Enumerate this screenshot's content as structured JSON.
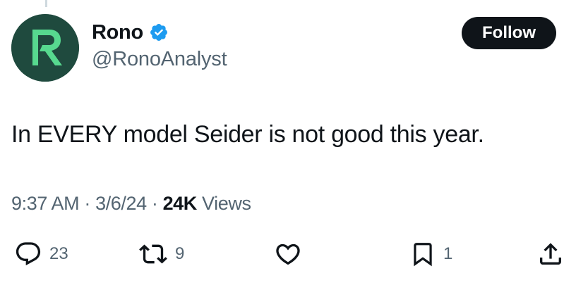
{
  "author": {
    "display_name": "Rono",
    "handle": "@RonoAnalyst",
    "avatar_letter": "R",
    "avatar_bg": "#1f4a3e",
    "avatar_fg": "#57d98f",
    "verified": true,
    "verified_color": "#1d9bf0"
  },
  "follow_button": {
    "label": "Follow"
  },
  "tweet": {
    "text": "In EVERY model Seider is not good this year.",
    "time": "9:37 AM",
    "date": "3/6/24",
    "separator": "·",
    "views_count": "24K",
    "views_label": "Views"
  },
  "actions": {
    "replies": "23",
    "reposts": "9",
    "likes": "",
    "bookmarks": "1"
  },
  "icons": {
    "reply": "reply-icon",
    "repost": "repost-icon",
    "like": "heart-icon",
    "bookmark": "bookmark-icon",
    "share": "share-icon",
    "verified": "verified-badge-icon"
  }
}
